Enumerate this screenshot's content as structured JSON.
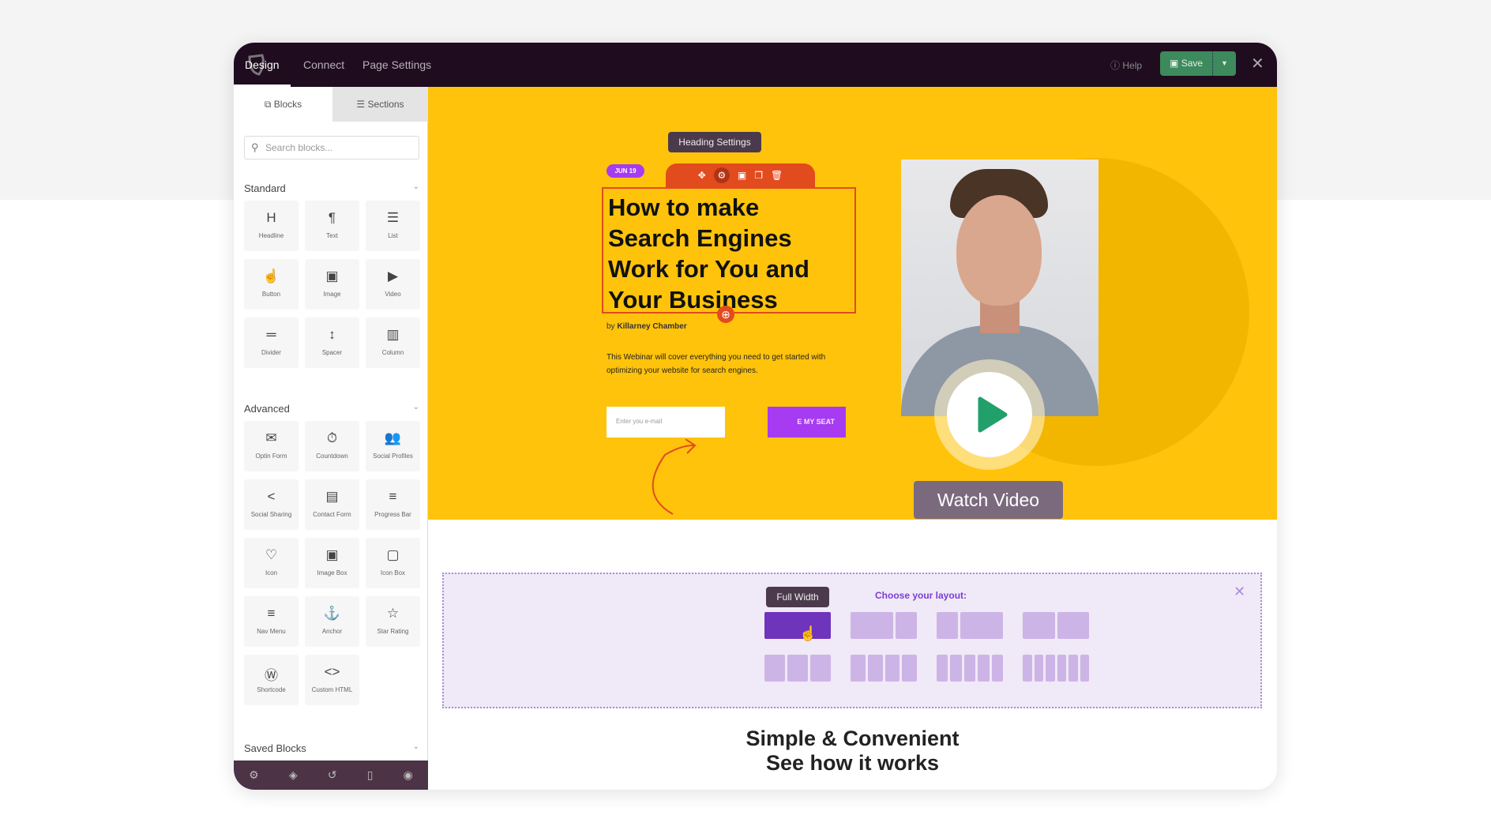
{
  "topbar": {
    "tabs": [
      "Design",
      "Connect",
      "Page Settings"
    ],
    "active_tab": "Design",
    "help": "Help",
    "save": "Save"
  },
  "sidebar": {
    "tabs": [
      "Blocks",
      "Sections"
    ],
    "search_placeholder": "Search blocks...",
    "standard": {
      "title": "Standard",
      "items": [
        {
          "icon": "H",
          "label": "Headline"
        },
        {
          "icon": "¶",
          "label": "Text"
        },
        {
          "icon": "☰",
          "label": "List"
        },
        {
          "icon": "☝",
          "label": "Button"
        },
        {
          "icon": "▣",
          "label": "Image"
        },
        {
          "icon": "▶",
          "label": "Video"
        },
        {
          "icon": "═",
          "label": "Divider"
        },
        {
          "icon": "↕",
          "label": "Spacer"
        },
        {
          "icon": "▥",
          "label": "Column"
        }
      ]
    },
    "advanced": {
      "title": "Advanced",
      "items": [
        {
          "icon": "✉",
          "label": "Optin Form"
        },
        {
          "icon": "⏱",
          "label": "Countdown"
        },
        {
          "icon": "👥",
          "label": "Social Profiles"
        },
        {
          "icon": "<",
          "label": "Social Sharing"
        },
        {
          "icon": "▤",
          "label": "Contact Form"
        },
        {
          "icon": "≡",
          "label": "Progress Bar"
        },
        {
          "icon": "♡",
          "label": "Icon"
        },
        {
          "icon": "▣",
          "label": "Image Box"
        },
        {
          "icon": "▢",
          "label": "Icon Box"
        },
        {
          "icon": "≡",
          "label": "Nav Menu"
        },
        {
          "icon": "⚓",
          "label": "Anchor"
        },
        {
          "icon": "☆",
          "label": "Star Rating"
        },
        {
          "icon": "Ⓦ",
          "label": "Shortcode"
        },
        {
          "icon": "<>",
          "label": "Custom HTML"
        }
      ]
    },
    "saved_title": "Saved Blocks",
    "bottom_icons": [
      "gear-icon",
      "layers-icon",
      "history-icon",
      "mobile-icon",
      "eye-icon"
    ]
  },
  "canvas": {
    "tooltip": "Heading Settings",
    "badge": "JUN 19",
    "heading_lines": [
      "How to make",
      "Search Engines",
      "Work for You and",
      "Your Business"
    ],
    "by_prefix": "by",
    "author": "Killarney Chamber",
    "paragraph": "This Webinar will cover everything you need to get started with optimizing your website for search engines.",
    "email_placeholder": "Enter you e-mail",
    "seat_button": "E MY SEAT",
    "watch_video": "Watch Video"
  },
  "layout_chooser": {
    "tooltip": "Full Width",
    "title": "Choose your layout:",
    "layouts": [
      [
        1
      ],
      [
        2,
        1
      ],
      [
        1,
        2
      ],
      [
        1,
        1
      ],
      [
        1,
        1,
        1
      ],
      [
        1,
        1,
        1,
        1
      ],
      [
        1,
        1,
        1,
        1,
        1
      ],
      [
        1,
        1,
        1,
        1,
        1,
        1
      ]
    ],
    "selected": 0
  },
  "section": {
    "line1": "Simple & Convenient",
    "line2": "See how it works"
  },
  "colors": {
    "topbar": "#1f0c1f",
    "canvas": "#ffc30b",
    "accent": "#e24b1e",
    "purple": "#a63bf2",
    "save": "#3d8a5c"
  }
}
